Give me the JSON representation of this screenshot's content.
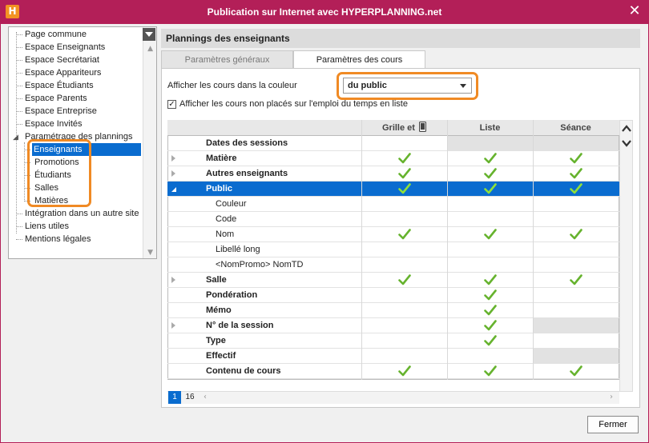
{
  "window": {
    "title": "Publication sur Internet avec HYPERPLANNING.net",
    "logo": "H",
    "close": "✕"
  },
  "tree": {
    "items": [
      {
        "label": "Page commune"
      },
      {
        "label": "Espace Enseignants"
      },
      {
        "label": "Espace Secrétariat"
      },
      {
        "label": "Espace Appariteurs"
      },
      {
        "label": "Espace Étudiants"
      },
      {
        "label": "Espace Parents"
      },
      {
        "label": "Espace Entreprise"
      },
      {
        "label": "Espace Invités"
      },
      {
        "label": "Paramétrage des plannings"
      },
      {
        "label": "Enseignants"
      },
      {
        "label": "Promotions"
      },
      {
        "label": "Étudiants"
      },
      {
        "label": "Salles"
      },
      {
        "label": "Matières"
      },
      {
        "label": "Intégration dans un autre site"
      },
      {
        "label": "Liens utiles"
      },
      {
        "label": "Mentions légales"
      }
    ]
  },
  "panel": {
    "title": "Plannings des enseignants",
    "tabs": [
      {
        "label": "Paramètres généraux"
      },
      {
        "label": "Paramètres des cours"
      }
    ],
    "color_label": "Afficher les cours dans la couleur",
    "color_value": "du public",
    "unplaced_label": "Afficher les cours non placés sur l'emploi du temps en liste",
    "unplaced_mark": "✓"
  },
  "grid": {
    "columns": [
      "Grille et",
      "Liste",
      "Séance"
    ],
    "rows": [
      {
        "label": "Dates des sessions"
      },
      {
        "label": "Matière"
      },
      {
        "label": "Autres enseignants"
      },
      {
        "label": "Public"
      },
      {
        "label": "Couleur"
      },
      {
        "label": "Code"
      },
      {
        "label": "Nom"
      },
      {
        "label": "Libellé long"
      },
      {
        "label": "<NomPromo> NomTD"
      },
      {
        "label": "Salle"
      },
      {
        "label": "Pondération"
      },
      {
        "label": "Mémo"
      },
      {
        "label": "N° de la session"
      },
      {
        "label": "Type"
      },
      {
        "label": "Effectif"
      },
      {
        "label": "Contenu de cours"
      }
    ],
    "pages": [
      "1",
      "16"
    ]
  },
  "footer": {
    "close_label": "Fermer"
  }
}
